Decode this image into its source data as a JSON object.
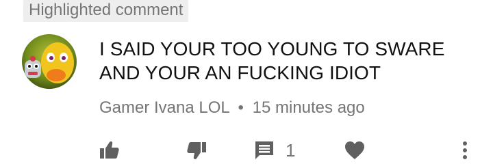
{
  "badge": {
    "label": "Highlighted comment"
  },
  "comment": {
    "text_lines": [
      "I SAID YOUR TOO YOUNG TO SWARE",
      "AND YOUR AN FUCKING IDIOT"
    ],
    "author": "Gamer Ivana LOL",
    "separator": "•",
    "time": "15 minutes ago"
  },
  "actions": {
    "like_icon": "thumbs-up-icon",
    "dislike_icon": "thumbs-down-icon",
    "reply_icon": "reply-comment-icon",
    "reply_count": "1",
    "heart_icon": "heart-icon",
    "more_icon": "more-vertical-icon"
  },
  "colors": {
    "text": "#111111",
    "secondary": "#757575",
    "icon": "#606060",
    "badge_bg": "#eeeeee"
  }
}
